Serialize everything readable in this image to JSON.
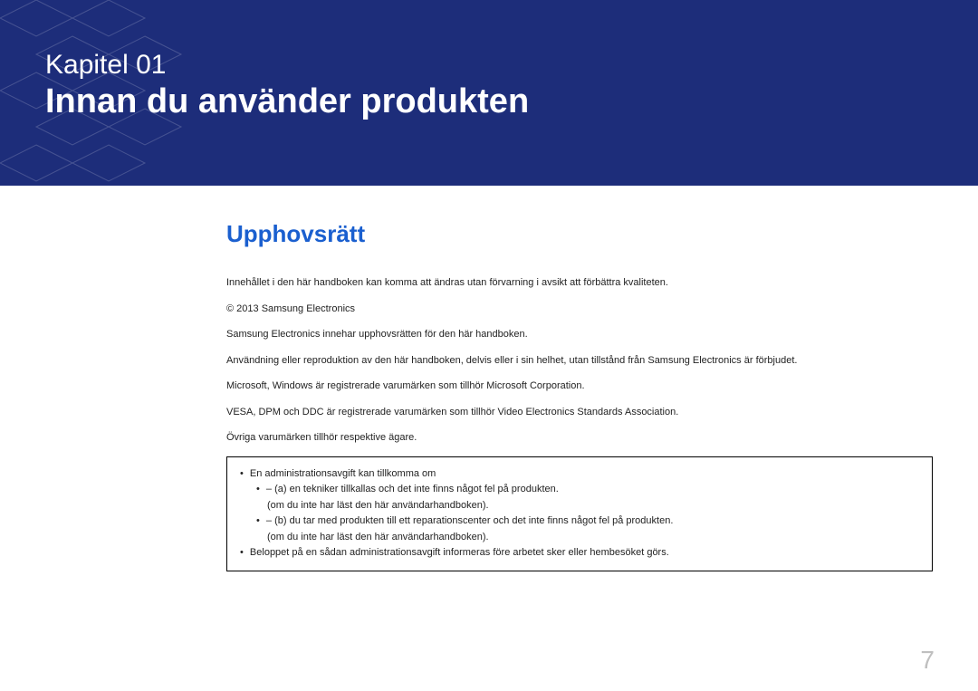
{
  "banner": {
    "chapter_label": "Kapitel 01",
    "chapter_title": "Innan du använder produkten"
  },
  "section_heading": "Upphovsrätt",
  "paragraphs": [
    "Innehållet i den här handboken kan komma att ändras utan förvarning i avsikt att förbättra kvaliteten.",
    "© 2013 Samsung Electronics",
    "Samsung Electronics innehar upphovsrätten för den här handboken.",
    "Användning eller reproduktion av den här handboken, delvis eller i sin helhet, utan tillstånd från Samsung Electronics är förbjudet.",
    "Microsoft, Windows är registrerade varumärken som tillhör Microsoft Corporation.",
    "VESA, DPM och DDC är registrerade varumärken som tillhör Video Electronics Standards Association.",
    "Övriga varumärken tillhör respektive ägare."
  ],
  "notice": {
    "intro": "En administrationsavgift kan tillkomma om",
    "items": [
      {
        "main": "(a) en tekniker tillkallas och det inte finns något fel på produkten.",
        "sub": "(om du inte har läst den här användarhandboken)."
      },
      {
        "main": "(b) du tar med produkten till ett reparationscenter och det inte finns något fel på produkten.",
        "sub": "(om du inte har läst den här användarhandboken)."
      }
    ],
    "footer": "Beloppet på en sådan administrationsavgift informeras före arbetet sker eller hembesöket görs."
  },
  "page_number": "7"
}
